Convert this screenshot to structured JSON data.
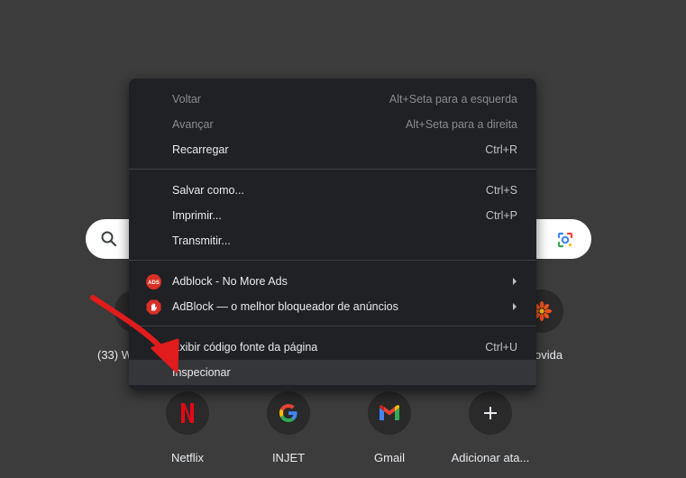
{
  "colors": {
    "page_background": "#3c3c3c",
    "menu_background": "#202124",
    "menu_highlight": "#35363a",
    "annotation_arrow": "#e01c1c"
  },
  "search": {
    "left_icon": "search-icon",
    "right_icon": "google-lens-icon"
  },
  "shortcuts_row1": {
    "left_label_partial": "(33) W",
    "right_label_partial": "ovida"
  },
  "shortcuts_row2": [
    {
      "label": "Netflix",
      "icon": "netflix-icon"
    },
    {
      "label": "INJET",
      "icon": "google-icon"
    },
    {
      "label": "Gmail",
      "icon": "gmail-icon"
    },
    {
      "label": "Adicionar ata...",
      "icon": "plus-icon"
    }
  ],
  "context_menu": {
    "back": {
      "label": "Voltar",
      "shortcut": "Alt+Seta para a esquerda"
    },
    "forward": {
      "label": "Avançar",
      "shortcut": "Alt+Seta para a direita"
    },
    "reload": {
      "label": "Recarregar",
      "shortcut": "Ctrl+R"
    },
    "save_as": {
      "label": "Salvar como...",
      "shortcut": "Ctrl+S"
    },
    "print": {
      "label": "Imprimir...",
      "shortcut": "Ctrl+P"
    },
    "cast": {
      "label": "Transmitir..."
    },
    "adblock_nomoreads": {
      "label": "Adblock - No More Ads",
      "icon_text": "ADS"
    },
    "adblock_best": {
      "label": "AdBlock — o melhor bloqueador de anúncios"
    },
    "view_source": {
      "label": "Exibir código fonte da página",
      "shortcut": "Ctrl+U"
    },
    "inspect": {
      "label": "Inspecionar"
    }
  }
}
